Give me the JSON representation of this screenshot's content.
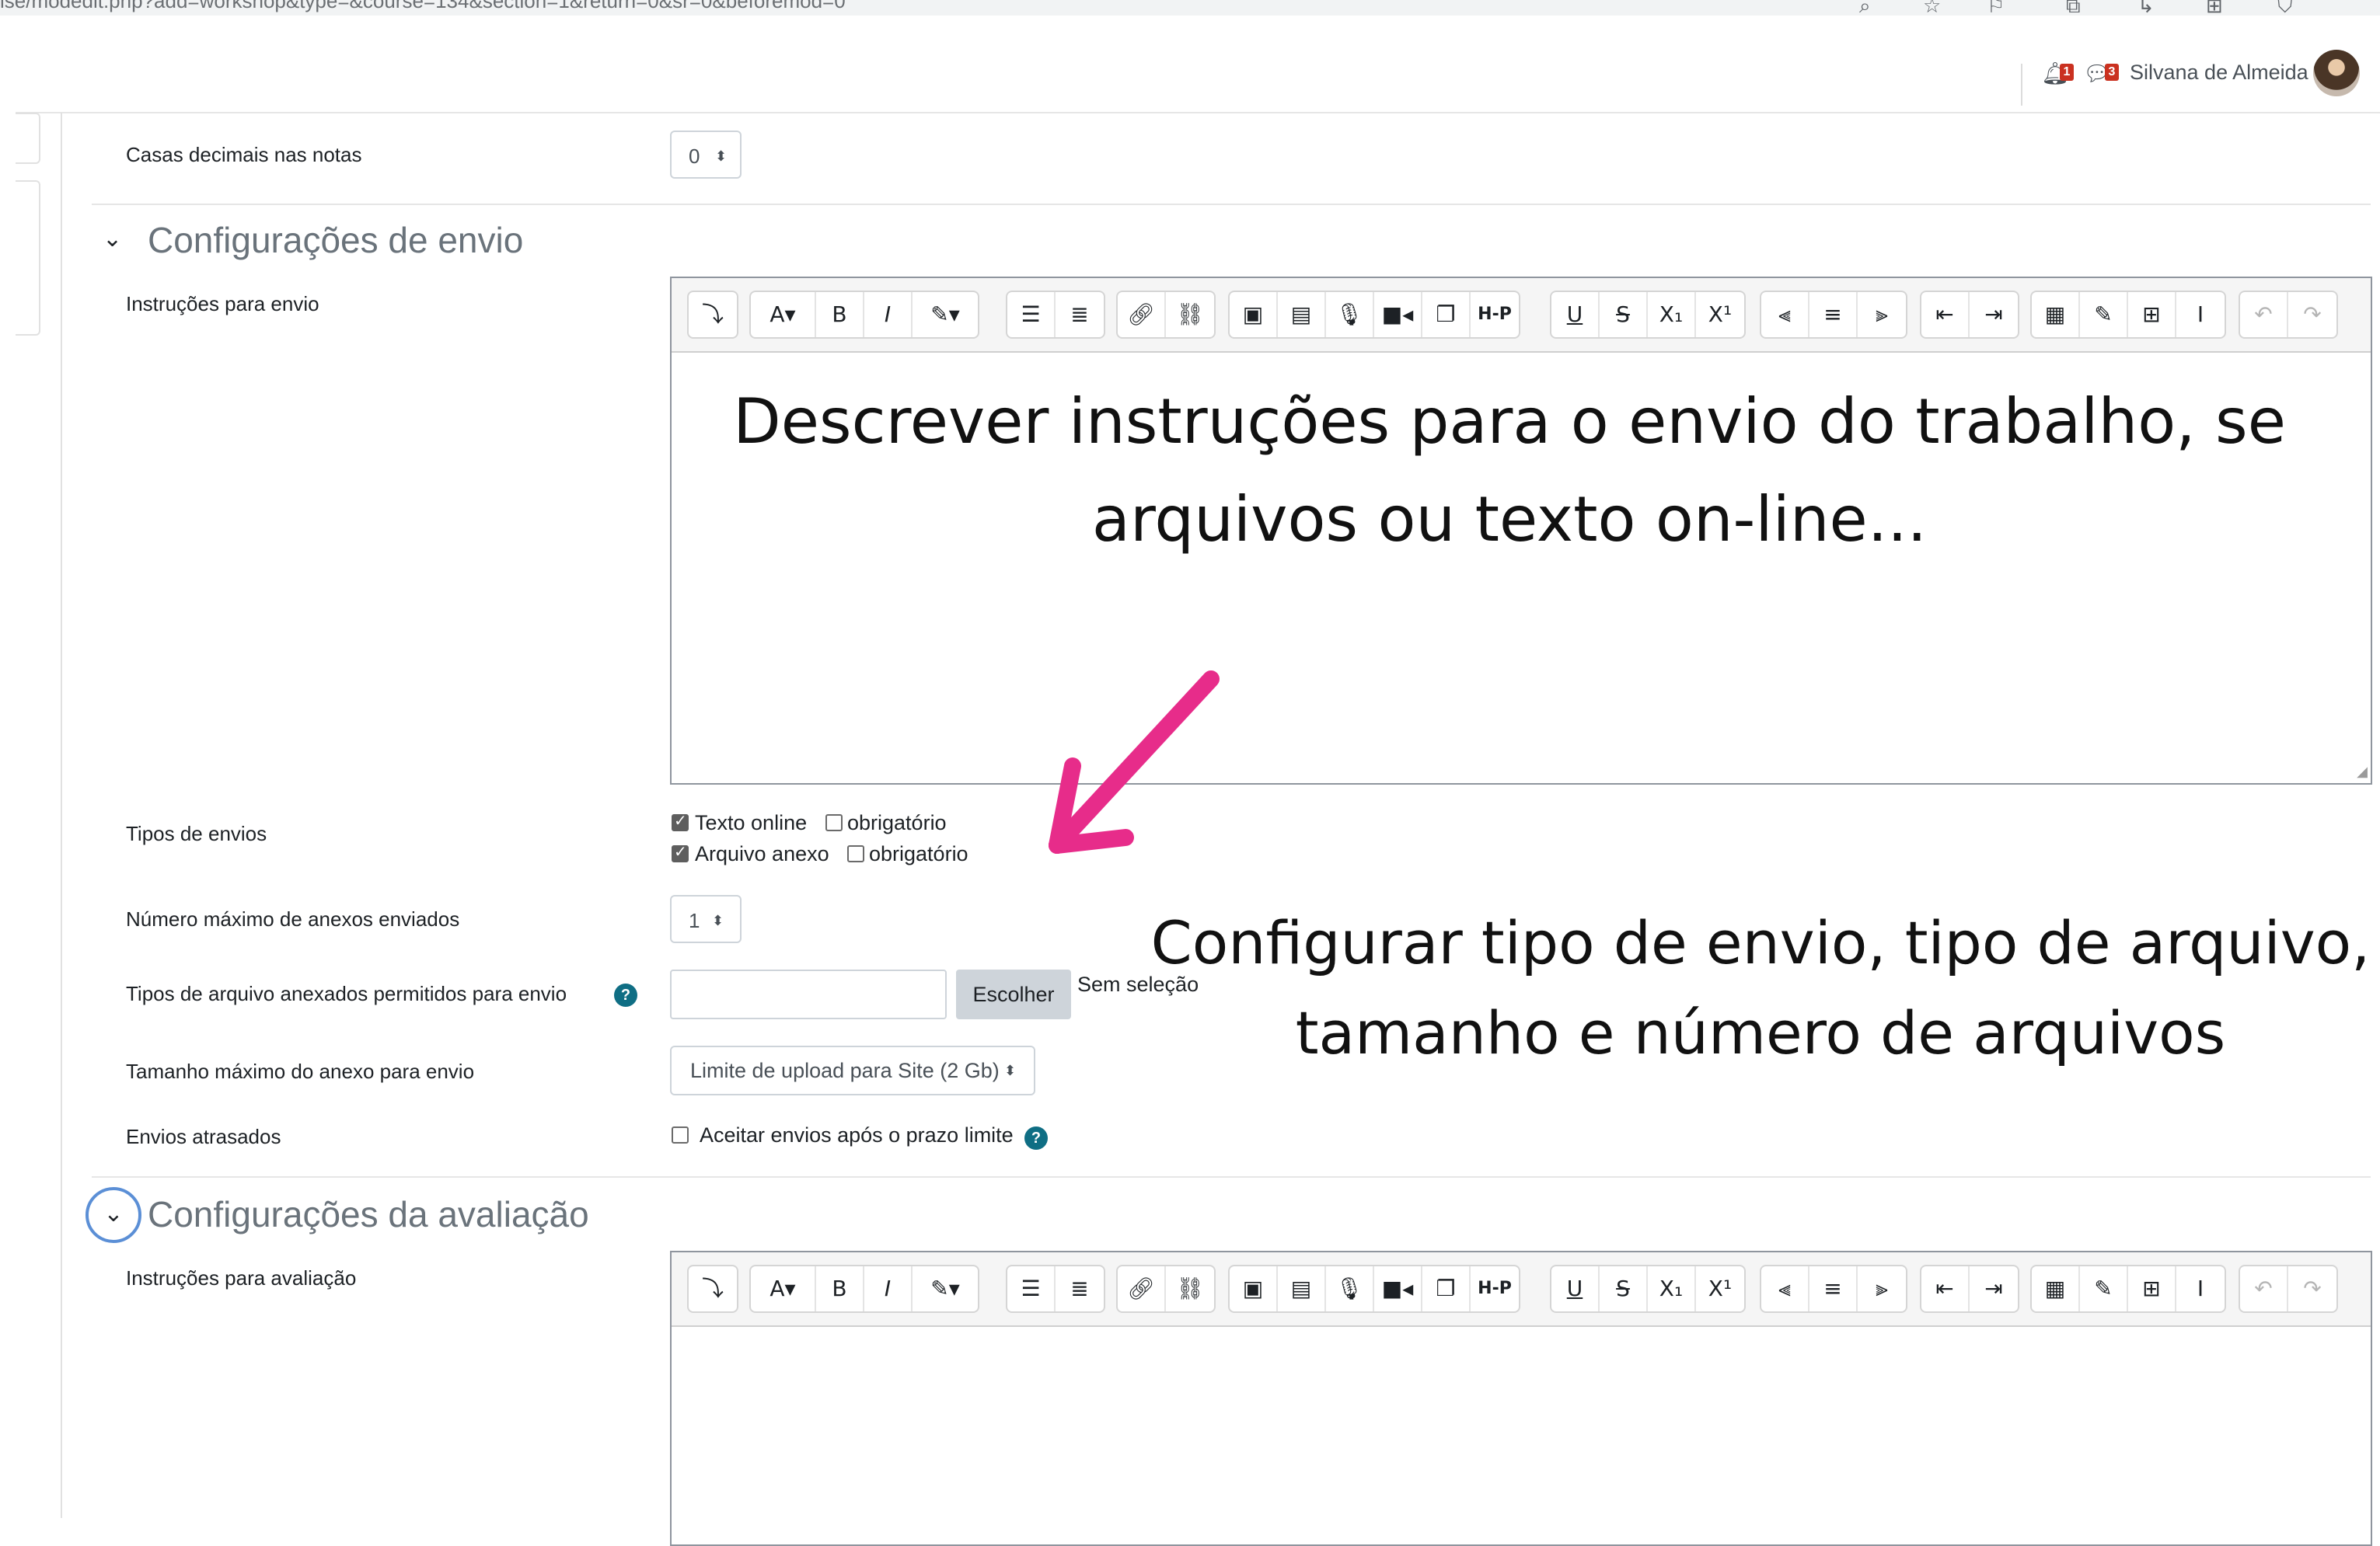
{
  "browser": {
    "url": "lse/modedit.php?add=workshop&type=&course=134&section=1&return=0&sr=0&beforemod=0",
    "icons": [
      "search-icon",
      "star-icon",
      "bookmark-icon",
      "extensions-icon",
      "history-icon",
      "tab-icon",
      "shield-icon"
    ]
  },
  "navbar": {
    "notifications_count": "1",
    "messages_count": "3",
    "user_name": "Silvana de Almeida"
  },
  "form": {
    "decimal_places": {
      "label": "Casas decimais nas notas",
      "value": "0"
    },
    "submission_section": {
      "title": "Configurações de envio",
      "instructions_label": "Instruções para envio",
      "submission_types_label": "Tipos de envios",
      "types": [
        {
          "label": "Texto online",
          "checked": true,
          "required_label": "obrigatório",
          "required": false
        },
        {
          "label": "Arquivo anexo",
          "checked": true,
          "required_label": "obrigatório",
          "required": false
        }
      ],
      "max_attachments_label": "Número máximo de anexos enviados",
      "max_attachments_value": "1",
      "allowed_types_label": "Tipos de arquivo anexados permitidos para envio",
      "choose_button": "Escolher",
      "no_selection": "Sem seleção",
      "max_size_label": "Tamanho máximo do anexo para envio",
      "max_size_value": "Limite de upload para Site (2 Gb)",
      "late_label": "Envios atrasados",
      "late_checkbox": "Aceitar envios após o prazo limite"
    },
    "assessment_section": {
      "title": "Configurações da avaliação",
      "instructions_label": "Instruções para avaliação"
    }
  },
  "toolbar_icons": [
    "collapse-icon",
    "font-color-icon",
    "bold-icon",
    "italic-icon",
    "highlight-icon",
    "unordered-list-icon",
    "ordered-list-icon",
    "link-icon",
    "unlink-icon",
    "image-icon",
    "media-icon",
    "record-audio-icon",
    "record-video-icon",
    "manage-files-icon",
    "h5p-icon",
    "underline-icon",
    "strikethrough-icon",
    "subscript-icon",
    "superscript-icon",
    "align-left-icon",
    "align-center-icon",
    "align-right-icon",
    "outdent-icon",
    "indent-icon",
    "equation-icon",
    "special-chars-icon",
    "table-icon",
    "clear-formatting-icon",
    "undo-icon",
    "redo-icon"
  ],
  "annotations": {
    "editor_line1": "Descrever instruções para o envio do trabalho, se",
    "editor_line2": "arquivos ou texto on-line...",
    "config_line1": "Configurar tipo de envio, tipo de arquivo,",
    "config_line2": "tamanho e número de arquivos"
  },
  "colors": {
    "annotation_arrow": "#e72c8a",
    "help_icon": "#0f6e84",
    "focus_ring": "#5b8fd6"
  }
}
